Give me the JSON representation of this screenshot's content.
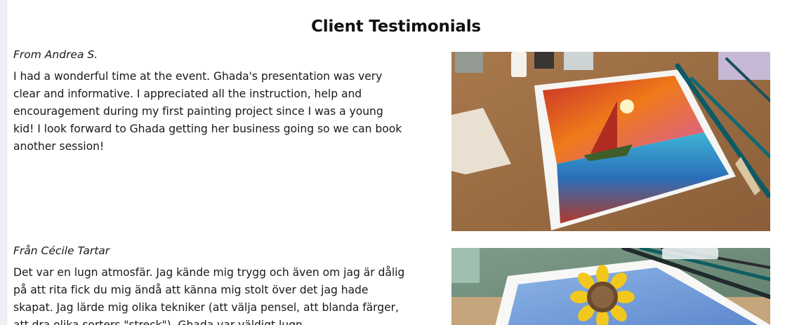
{
  "section": {
    "title": "Client Testimonials"
  },
  "testimonials": [
    {
      "author": "From Andrea S.",
      "text": "I had a wonderful time at the event. Ghada's presentation was very clear and informative. I appreciated all the instruction, help and encouragement during my first painting project since I was a young kid! I look forward to Ghada getting her business going so we can book another session!"
    },
    {
      "author": "Från Cécile Tartar",
      "text": "Det var en lugn atmosfär. Jag kände mig trygg och även om jag är dålig på att rita fick du mig ändå att känna mig stolt över det jag hade skapat. Jag lärde mig olika tekniker (att välja pensel, att blanda färger, att dra olika sorters \"streck\"). Ghada var väldigt lugn"
    }
  ],
  "images": [
    {
      "icon": "sailboat-sunset-painting-photo"
    },
    {
      "icon": "sunflower-painting-photo"
    }
  ]
}
